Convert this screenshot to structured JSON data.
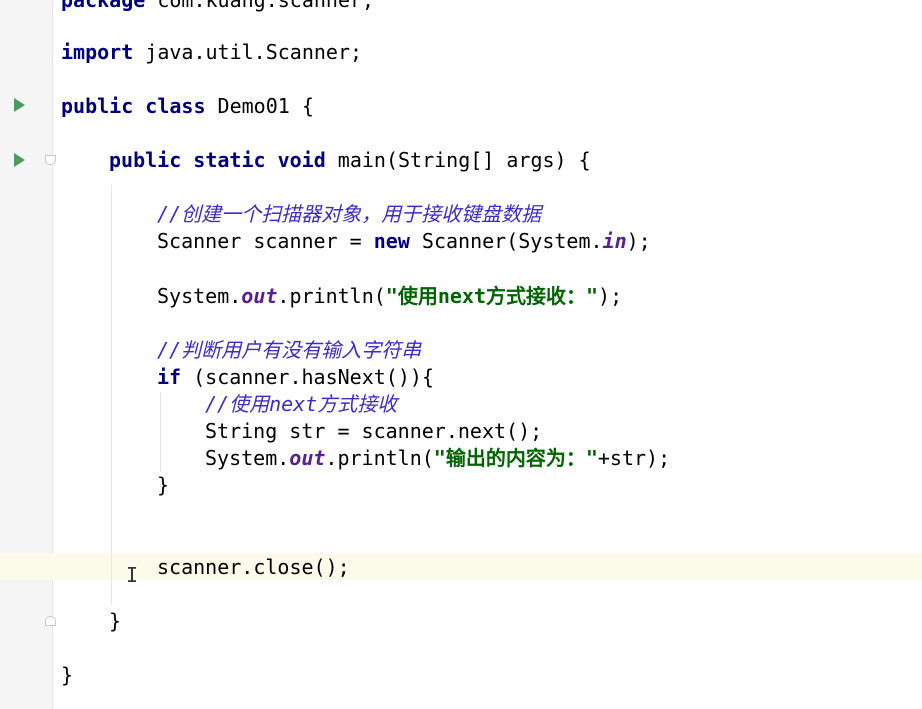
{
  "code": {
    "line_package": {
      "keyword": "package",
      "text": " com.kuang.scanner;"
    },
    "line_import": {
      "keyword": "import",
      "text": " java.util.Scanner;"
    },
    "line_class": {
      "kw1": "public",
      "kw2": "class",
      "text": " Demo01 {"
    },
    "line_main": {
      "kw1": "public",
      "kw2": "static",
      "kw3": "void",
      "text": " main(String[] args) {"
    },
    "comment_create": "//创建一个扫描器对象，用于接收键盘数据",
    "line_scanner": {
      "pre": "Scanner scanner = ",
      "kw": "new",
      "mid": " Scanner(System.",
      "field": "in",
      "post": ");"
    },
    "line_println1": {
      "pre": "System.",
      "field": "out",
      "mid": ".println(",
      "str": "\"使用next方式接收：\"",
      "post": ");"
    },
    "comment_judge": "//判断用户有没有输入字符串",
    "line_if": {
      "kw": "if",
      "text": " (scanner.hasNext()){"
    },
    "comment_next": "//使用next方式接收",
    "line_str": "String str = scanner.next();",
    "line_println2": {
      "pre": "System.",
      "field": "out",
      "mid": ".println(",
      "str": "\"输出的内容为：\"",
      "post": "+str);"
    },
    "brace_if": "}",
    "line_close": "scanner.close();",
    "brace_main": "}",
    "brace_class": "}"
  },
  "cursor": {
    "glyph": "I"
  },
  "icons": [
    "run-icon",
    "fold-open-icon",
    "fold-close-icon",
    "text-cursor-icon"
  ],
  "colors": {
    "keyword": "#000080",
    "comment": "#3b2cc8",
    "string": "#006400",
    "field": "#5c1e93",
    "current_line": "#fcfae8",
    "run_icon": "#4f9a5c"
  }
}
